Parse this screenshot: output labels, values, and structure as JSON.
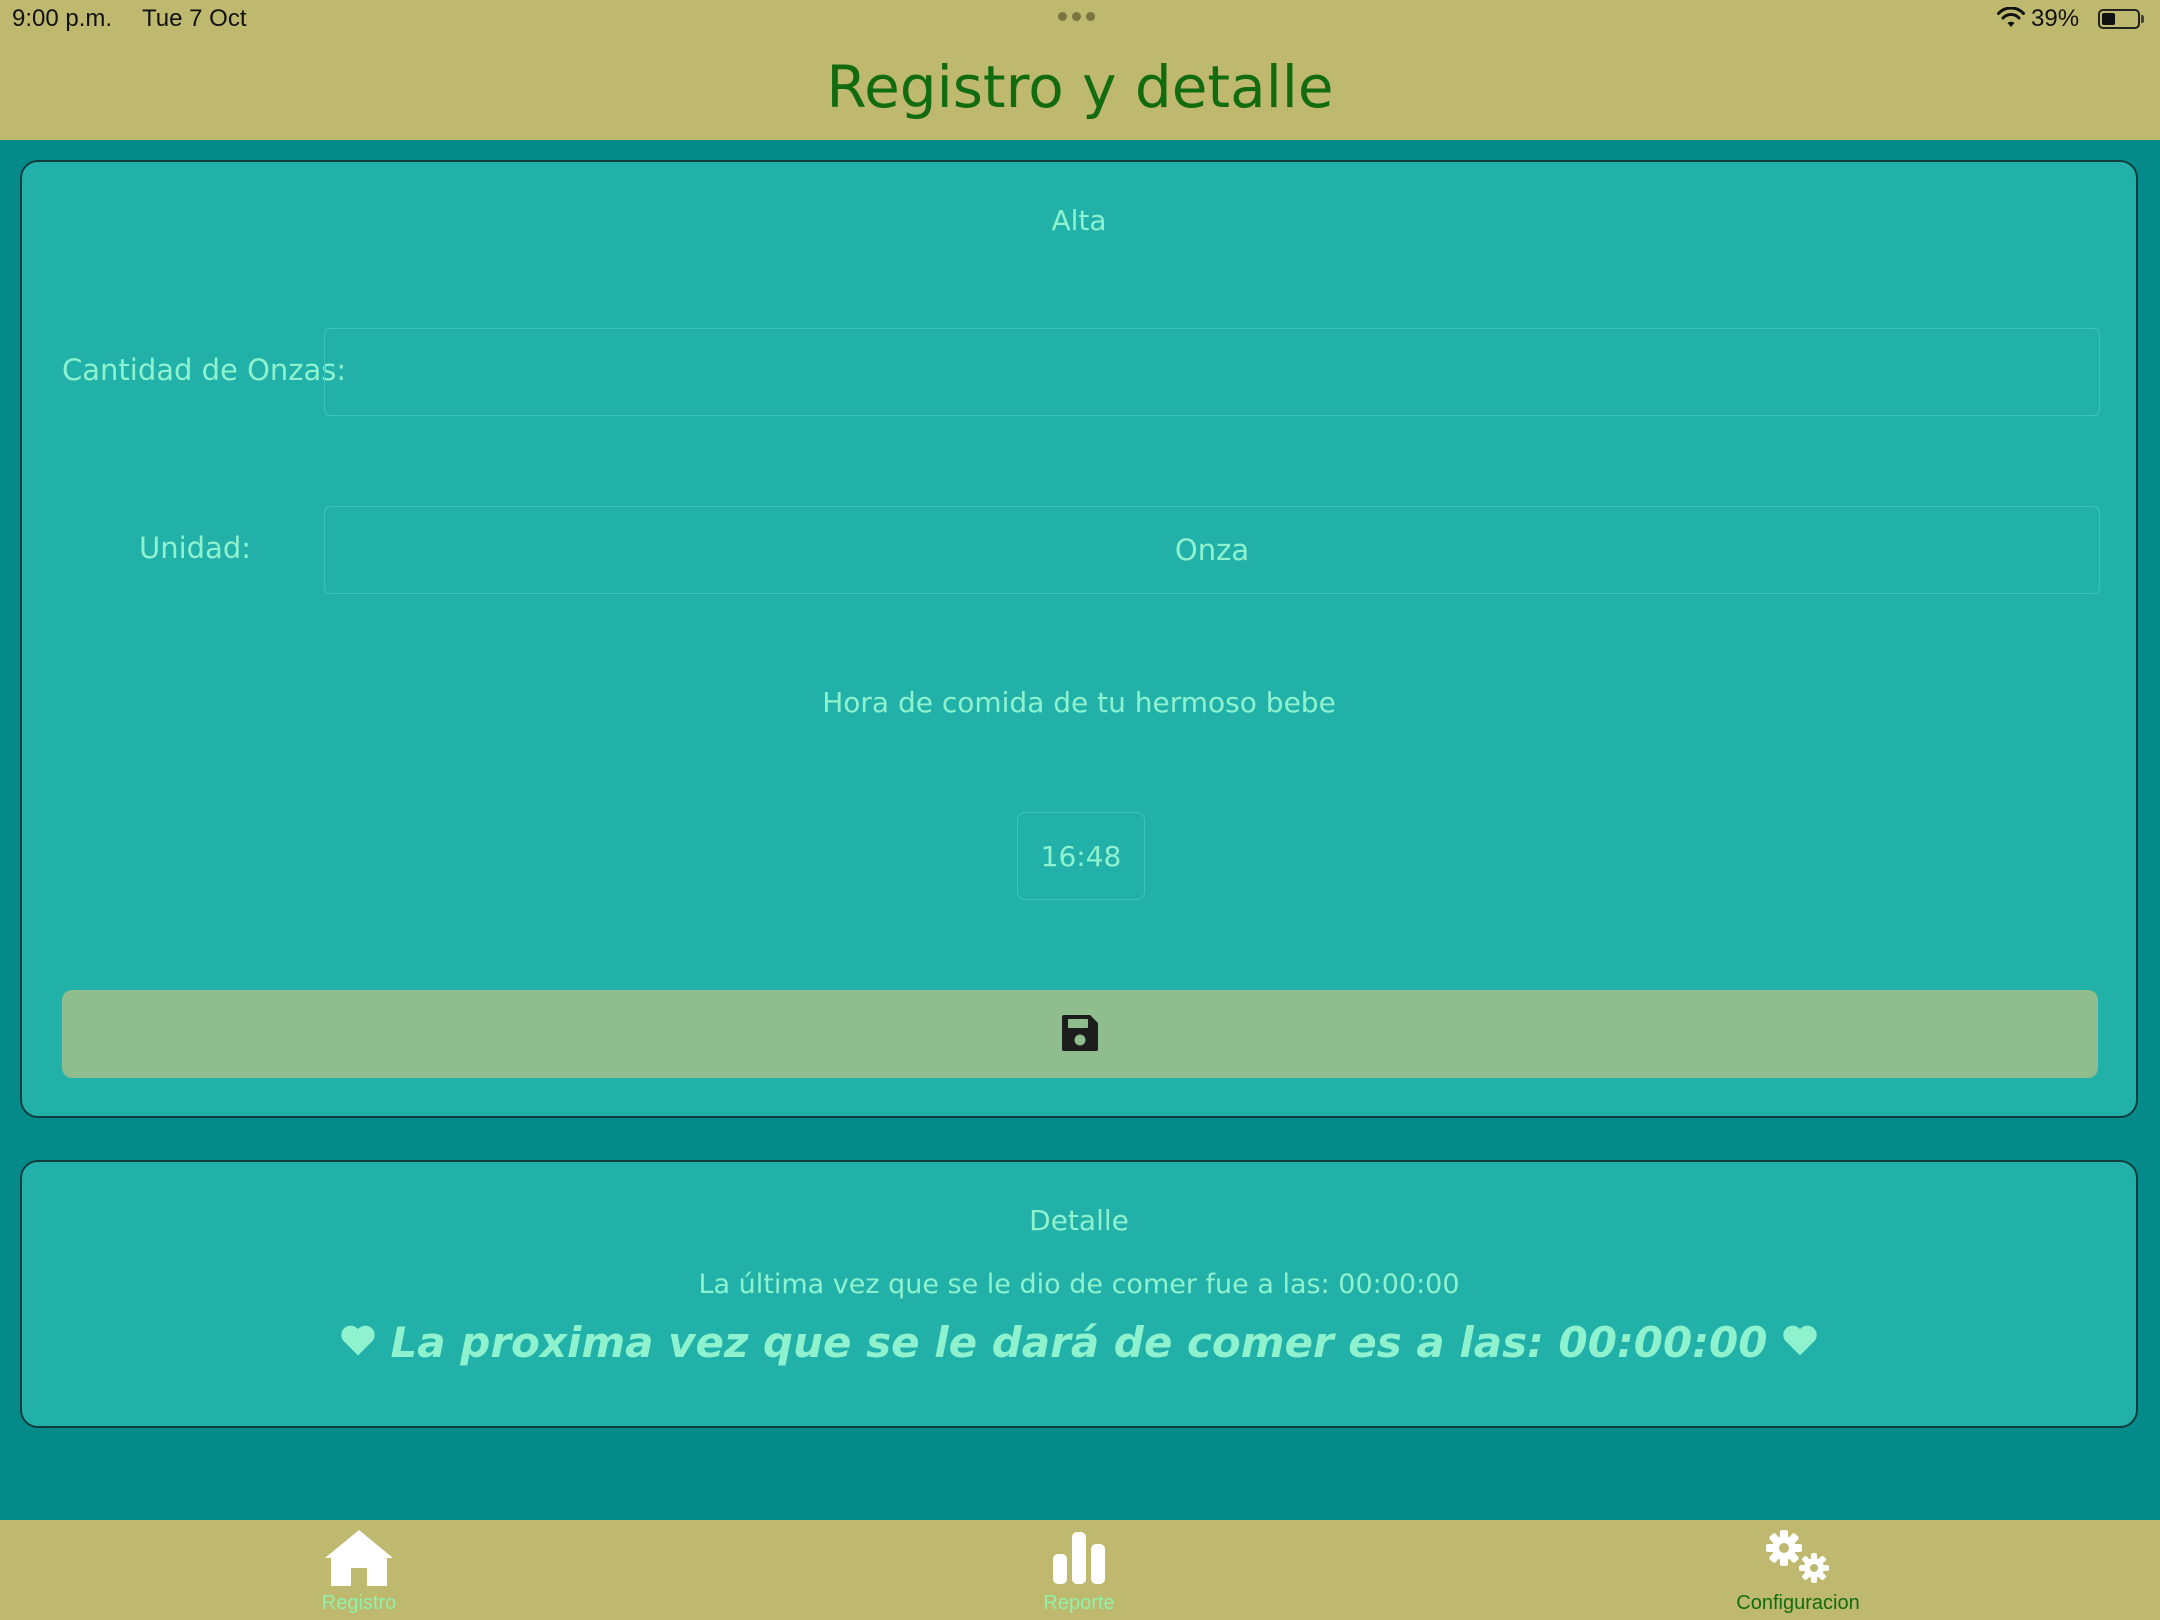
{
  "status_bar": {
    "time": "9:00 p.m.",
    "date": "Tue 7 Oct",
    "battery": "39%",
    "battery_level": 0.39
  },
  "header": {
    "title": "Registro y detalle"
  },
  "alta": {
    "title": "Alta",
    "onzas_label": "Cantidad de Onzas:",
    "onzas_value": "",
    "unidad_label": "Unidad:",
    "unidad_value": "Onza",
    "hora_label": "Hora de comida de tu hermoso bebe",
    "hora_value": "16:48",
    "save_icon": "floppy-disk-icon"
  },
  "detalle": {
    "title": "Detalle",
    "last_feed": "La última vez que se le dio de comer fue a las: 00:00:00",
    "next_feed": "La proxima vez que se le dará de comer es a las: 00:00:00"
  },
  "tabs": [
    {
      "label": "Registro",
      "icon": "home-icon",
      "color": "#8ff2a8"
    },
    {
      "label": "Reporte",
      "icon": "bar-chart-icon",
      "color": "#8ff2a8"
    },
    {
      "label": "Configuracion",
      "icon": "gears-icon",
      "color": "#126b0f"
    }
  ],
  "colors": {
    "header_bg": "#bfb96f",
    "page_bg": "#058a8a",
    "card_bg": "#21b1a9",
    "accent_text": "#8ff2cf",
    "title_green": "#126b0f",
    "save_button": "#8fbd8d"
  }
}
